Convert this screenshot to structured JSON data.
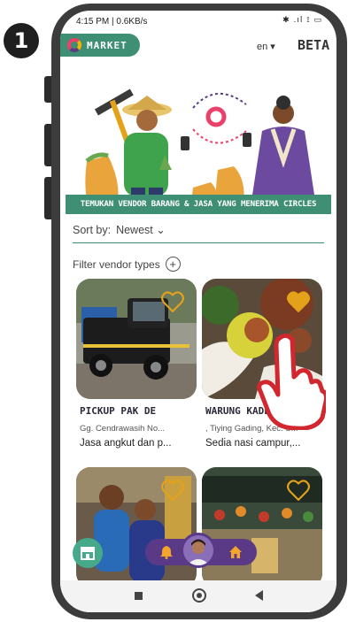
{
  "step": "1",
  "status_bar": {
    "time": "4:15 PM | 0.6KB/s",
    "system_icons": "✱ .ıl ⟟ ▭"
  },
  "header": {
    "app_name": "MARKET",
    "language": "en ▾",
    "beta_label": "BETA"
  },
  "hero": {
    "banner_text": "TEMUKAN VENDOR BARANG & JASA YANG MENERIMA CIRCLES"
  },
  "sort": {
    "label": "Sort by:",
    "value": "Newest",
    "chevron": "⌄"
  },
  "filter": {
    "label": "Filter vendor types",
    "add_symbol": "+"
  },
  "vendors": [
    {
      "name": "PICKUP PAK DE",
      "address": "Gg. Cendrawasih No...",
      "description": "Jasa angkut dan p..."
    },
    {
      "name": "WARUNG KADER",
      "address": ", Tiying Gading, Kec. S...",
      "description": "Sedia nasi campur,..."
    },
    {
      "name": "",
      "address": "",
      "description": ""
    },
    {
      "name": "",
      "address": "",
      "description": ""
    }
  ],
  "colors": {
    "primary_green": "#3f8f74",
    "dock_purple": "#5a3a86",
    "heart_gold": "#e3a21a",
    "accent_orange": "#f4a62a"
  },
  "icons": [
    "market-logo-icon",
    "heart-icon",
    "store-icon",
    "bell-icon",
    "home-icon",
    "pointing-hand-icon"
  ]
}
